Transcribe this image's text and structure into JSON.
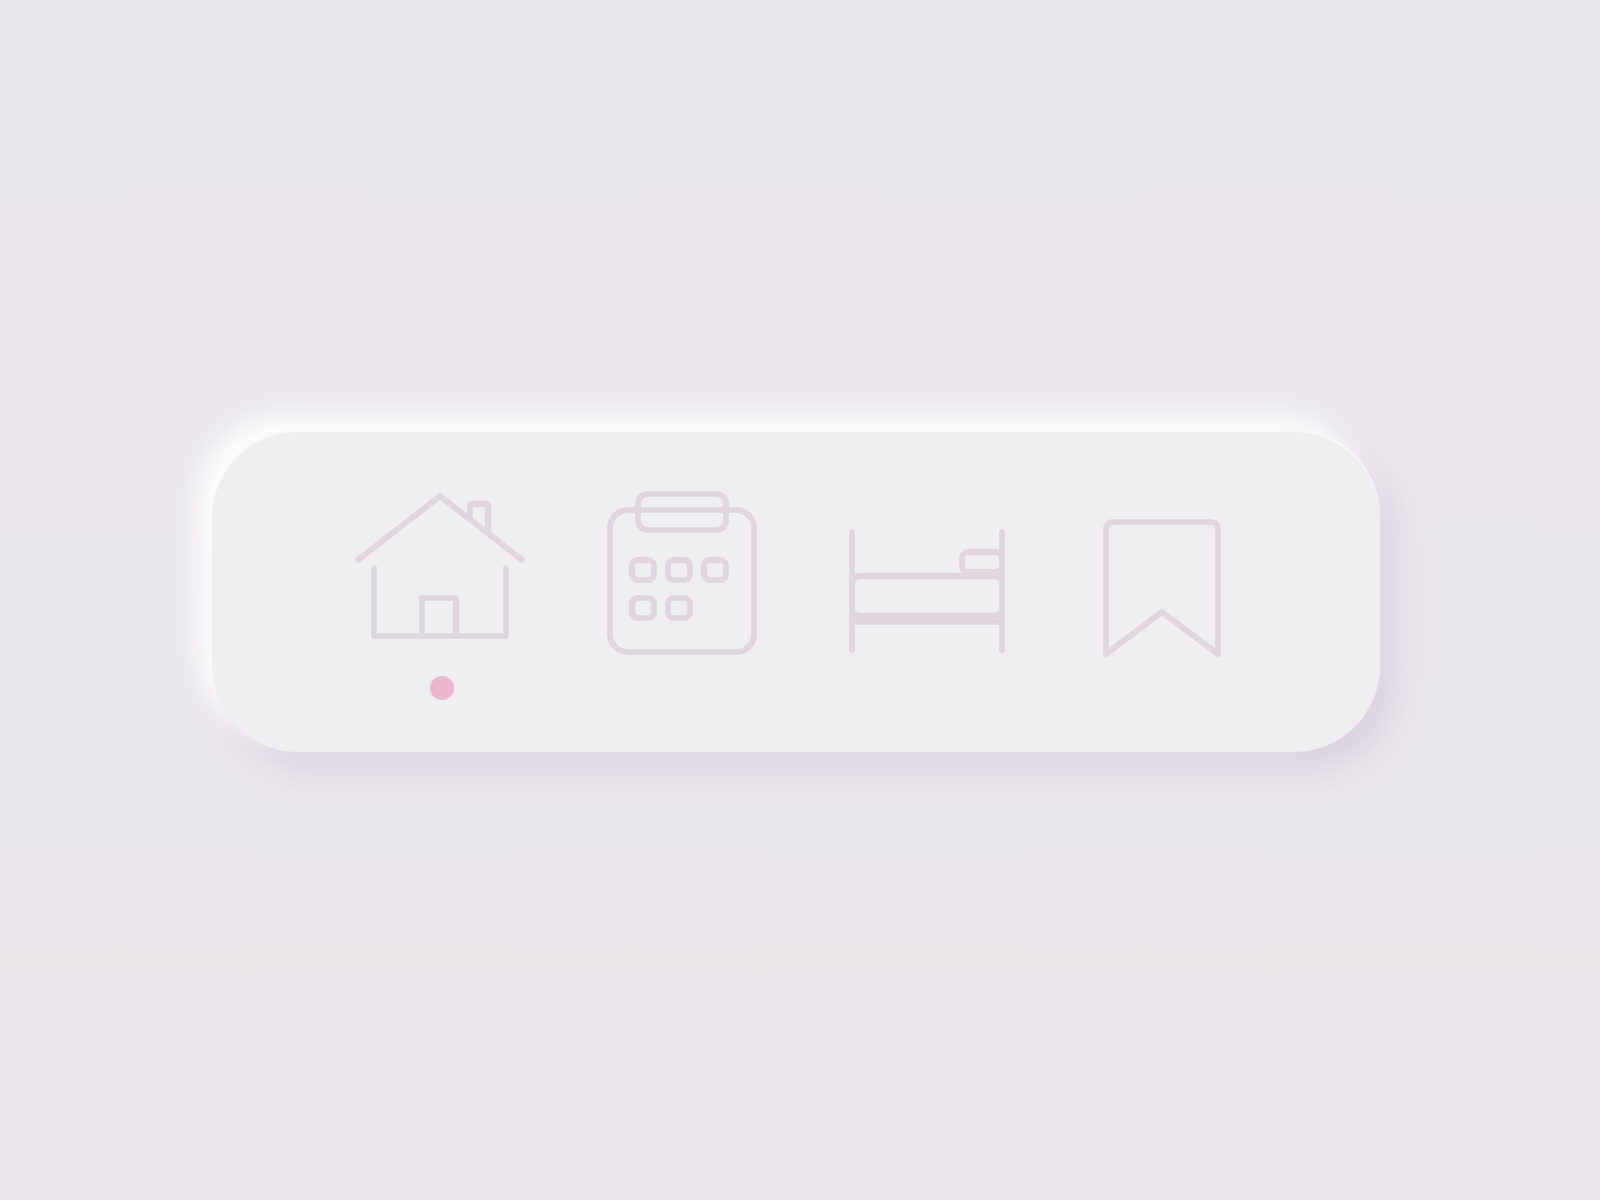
{
  "nav": {
    "items": [
      {
        "id": "home",
        "icon": "home-icon",
        "active": true
      },
      {
        "id": "calendar",
        "icon": "calendar-icon",
        "active": false
      },
      {
        "id": "bed",
        "icon": "bed-icon",
        "active": false
      },
      {
        "id": "bookmark",
        "icon": "bookmark-icon",
        "active": false
      }
    ],
    "active_index": 0
  },
  "colors": {
    "background": "#ece9ee",
    "bar": "#efeef1",
    "icon_stroke": "#e2d6de",
    "active_indicator": "#eab7cf"
  }
}
